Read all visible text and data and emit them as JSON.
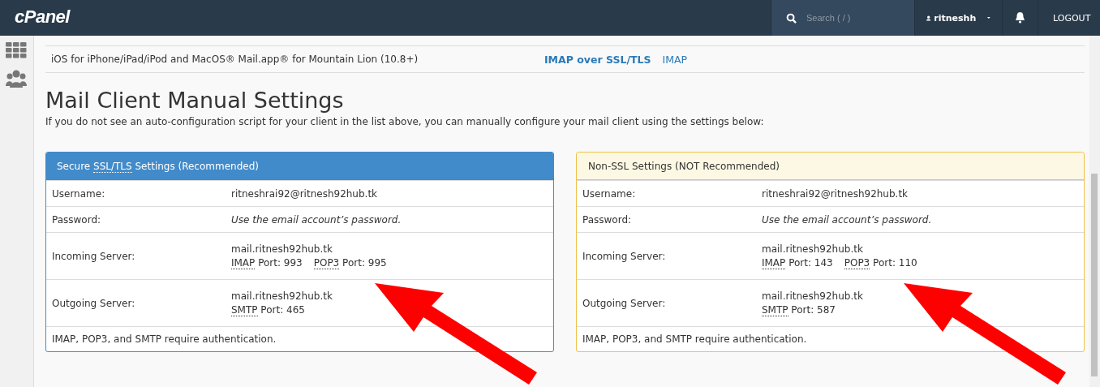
{
  "header": {
    "logo": "cPanel",
    "search": {
      "placeholder": "Search ( / )"
    },
    "user": "ritneshh",
    "logout": "LOGOUT"
  },
  "client_row": {
    "client": "iOS for iPhone/iPad/iPod and MacOS® Mail.app® for Mountain Lion (10.8+)",
    "link": "IMAP over SSL/TLS",
    "alt_link": "IMAP"
  },
  "title": "Mail Client Manual Settings",
  "intro": "If you do not see an auto-configuration script for your client in the list above, you can manually configure your mail client using the settings below:",
  "panels": [
    {
      "kind": "secure",
      "heading": [
        {
          "text": "Secure "
        },
        {
          "text": "SSL/TLS",
          "abbr": true
        },
        {
          "text": " Settings (Recommended)"
        }
      ],
      "rows": [
        {
          "label": "Username:",
          "value": "ritneshrai92@ritnesh92hub.tk"
        },
        {
          "label": "Password:",
          "value": "Use the email account’s password.",
          "italic": true
        },
        {
          "label": "Incoming Server:",
          "value": "mail.ritnesh92hub.tk",
          "ports": [
            {
              "protocol": "IMAP",
              "port": "Port: 993"
            },
            {
              "protocol": "POP3",
              "port": "Port: 995"
            }
          ]
        },
        {
          "label": "Outgoing Server:",
          "value": "mail.ritnesh92hub.tk",
          "ports": [
            {
              "protocol": "SMTP",
              "port": "Port: 465"
            }
          ]
        }
      ],
      "footer": "IMAP, POP3, and SMTP require authentication."
    },
    {
      "kind": "insecure",
      "heading": [
        {
          "text": "Non-SSL Settings (NOT Recommended)"
        }
      ],
      "rows": [
        {
          "label": "Username:",
          "value": "ritneshrai92@ritnesh92hub.tk"
        },
        {
          "label": "Password:",
          "value": "Use the email account’s password.",
          "italic": true
        },
        {
          "label": "Incoming Server:",
          "value": "mail.ritnesh92hub.tk",
          "ports": [
            {
              "protocol": "IMAP",
              "port": "Port: 143"
            },
            {
              "protocol": "POP3",
              "port": "Port: 110"
            }
          ]
        },
        {
          "label": "Outgoing Server:",
          "value": "mail.ritnesh92hub.tk",
          "ports": [
            {
              "protocol": "SMTP",
              "port": "Port: 587"
            }
          ]
        }
      ],
      "footer": "IMAP, POP3, and SMTP require authentication."
    }
  ]
}
